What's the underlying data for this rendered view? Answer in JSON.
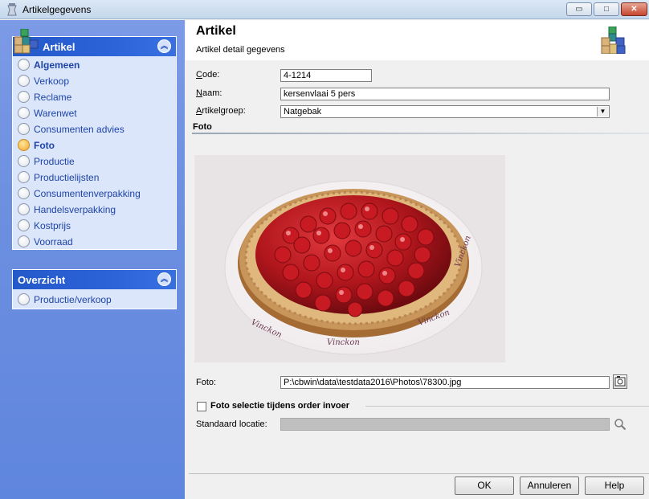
{
  "window": {
    "title": "Artikelgegevens",
    "controls": {
      "minimize": "▭",
      "maximize": "□",
      "close": "✕"
    }
  },
  "sidebar": {
    "artikel_panel": {
      "title": "Artikel",
      "items": [
        {
          "label": "Algemeen",
          "bold": true,
          "selected": false
        },
        {
          "label": "Verkoop",
          "bold": false,
          "selected": false
        },
        {
          "label": "Reclame",
          "bold": false,
          "selected": false
        },
        {
          "label": "Warenwet",
          "bold": false,
          "selected": false
        },
        {
          "label": "Consumenten advies",
          "bold": false,
          "selected": false
        },
        {
          "label": "Foto",
          "bold": true,
          "selected": true
        },
        {
          "label": "Productie",
          "bold": false,
          "selected": false
        },
        {
          "label": "Productielijsten",
          "bold": false,
          "selected": false
        },
        {
          "label": "Consumentenverpakking",
          "bold": false,
          "selected": false
        },
        {
          "label": "Handelsverpakking",
          "bold": false,
          "selected": false
        },
        {
          "label": "Kostprijs",
          "bold": false,
          "selected": false
        },
        {
          "label": "Voorraad",
          "bold": false,
          "selected": false
        }
      ]
    },
    "overzicht_panel": {
      "title": "Overzicht",
      "items": [
        {
          "label": "Productie/verkoop",
          "bold": false,
          "selected": false
        }
      ]
    }
  },
  "header": {
    "title": "Artikel",
    "subtitle": "Artikel detail gegevens"
  },
  "form": {
    "code": {
      "label_first": "C",
      "label_rest": "ode:",
      "value": "4-1214"
    },
    "naam": {
      "label_first": "N",
      "label_rest": "aam:",
      "value": "kersenvlaai 5 pers"
    },
    "artikelgroep": {
      "label_first": "A",
      "label_rest": "rtikelgroep:",
      "value": "Natgebak"
    }
  },
  "foto_section": {
    "heading": "Foto",
    "foto_label": "Foto:",
    "foto_path": "P:\\cbwin\\data\\testdata2016\\Photos\\78300.jpg",
    "order_checkbox_label": "Foto selectie tijdens order invoer",
    "order_checkbox_checked": false,
    "standaard_locatie_label": "Standaard locatie:",
    "standaard_locatie_value": ""
  },
  "buttons": {
    "ok": "OK",
    "annuleren": "Annuleren",
    "help": "Help"
  },
  "colors": {
    "sidebar_bg": "#6c8fe0",
    "panel_header": "#2459c9",
    "panel_body": "#dbe6fb",
    "nav_text": "#1e44a8",
    "selected_radio": "#f0a92a"
  }
}
